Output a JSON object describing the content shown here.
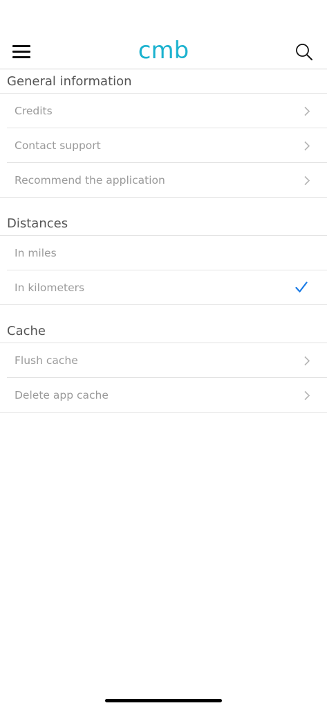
{
  "header": {
    "logo_text": "cmb",
    "menu_icon": "hamburger-icon",
    "search_icon": "search-icon"
  },
  "colors": {
    "brand": "#1bb2cf",
    "check": "#1a7be6",
    "row_text": "#9a9a9a",
    "section_text": "#555555"
  },
  "sections": {
    "general": {
      "title": "General information",
      "items": {
        "credits": "Credits",
        "contact": "Contact support",
        "recommend": "Recommend the application"
      }
    },
    "distances": {
      "title": "Distances",
      "items": {
        "miles": "In miles",
        "kilometers": "In kilometers"
      },
      "selected": "In kilometers"
    },
    "cache": {
      "title": "Cache",
      "items": {
        "flush": "Flush cache",
        "delete": "Delete app cache"
      }
    }
  }
}
